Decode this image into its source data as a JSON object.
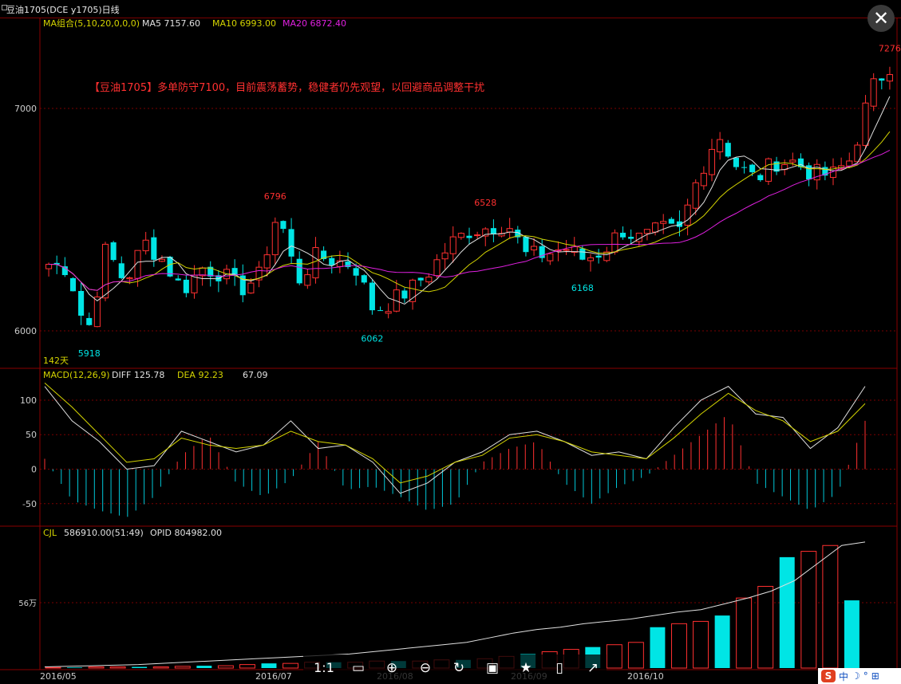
{
  "window": {
    "title": "豆油1705(DCE y1705)日线"
  },
  "toolbar": {
    "ratio_label": "1:1",
    "icons": [
      "fit-screen-icon",
      "zoom-in-icon",
      "zoom-out-icon",
      "rotate-icon",
      "save-icon",
      "bookmark-icon",
      "phone-icon",
      "share-icon"
    ]
  },
  "ime": {
    "logo": "S",
    "lang": "中",
    "moon": "☽",
    "dot": "°",
    "more": "⊞"
  },
  "chart_data": [
    {
      "type": "candlestick",
      "indicator_label": "MA组合(5,10,20,0,0,0)",
      "legend": [
        {
          "name": "MA5",
          "value": "7157.60",
          "color": "#e0e0e0"
        },
        {
          "name": "MA10",
          "value": "6993.00",
          "color": "#d4d400"
        },
        {
          "name": "MA20",
          "value": "6872.40",
          "color": "#e020e0"
        }
      ],
      "annotation": "【豆油1705】多单防守7100，目前震荡蓄势，稳健者仍先观望，以回避商品调整干扰",
      "y_ticks": [
        6000,
        7000
      ],
      "ylim": [
        5860,
        7380
      ],
      "peak_labels": [
        {
          "i": 2,
          "label": "5918",
          "low": true
        },
        {
          "i": 12,
          "label": "6796",
          "low": false
        },
        {
          "i": 17,
          "label": "6062",
          "low": true
        },
        {
          "i": 23,
          "label": "6528",
          "low": false
        },
        {
          "i": 28,
          "label": "6168",
          "low": true
        },
        {
          "i": 44,
          "label": "7276",
          "low": false
        }
      ],
      "bottom_label": "142天",
      "x_ticks": [
        "2016/05",
        "2016/07",
        "2016/08",
        "2016/09",
        "2016/10"
      ],
      "anchors": [
        [
          6330,
          6270
        ],
        [
          6370,
          6195
        ],
        [
          5920,
          6040
        ],
        [
          6440,
          6300
        ],
        [
          6290,
          6140
        ],
        [
          6280,
          6520
        ],
        [
          6400,
          6230
        ],
        [
          6140,
          6220
        ],
        [
          6340,
          6230
        ],
        [
          6180,
          6340
        ],
        [
          6220,
          6150
        ],
        [
          6350,
          6140
        ],
        [
          6440,
          6640
        ],
        [
          6230,
          6210
        ],
        [
          6390,
          6280
        ],
        [
          6290,
          6340
        ],
        [
          6410,
          6180
        ],
        [
          6100,
          6080
        ],
        [
          6100,
          6170
        ],
        [
          6170,
          6210
        ],
        [
          6230,
          6320
        ],
        [
          6290,
          6490
        ],
        [
          6430,
          6470
        ],
        [
          6440,
          6490
        ],
        [
          6510,
          6460
        ],
        [
          6380,
          6290
        ],
        [
          6350,
          6340
        ],
        [
          6370,
          6380
        ],
        [
          6440,
          6200
        ],
        [
          6300,
          6420
        ],
        [
          6430,
          6480
        ],
        [
          6370,
          6450
        ],
        [
          6430,
          6480
        ],
        [
          6350,
          6540
        ],
        [
          6630,
          6770
        ],
        [
          6880,
          6900
        ],
        [
          6780,
          6700
        ],
        [
          6710,
          6650
        ],
        [
          6760,
          6760
        ],
        [
          6680,
          6840
        ],
        [
          6800,
          6610
        ],
        [
          6700,
          6700
        ],
        [
          6760,
          6790
        ],
        [
          6970,
          7190
        ],
        [
          7180,
          7210
        ]
      ]
    },
    {
      "type": "line",
      "indicator_label": "MACD(12,26,9)",
      "legend": [
        {
          "name": "DIFF",
          "value": "125.78",
          "color": "#e0e0e0"
        },
        {
          "name": "DEA",
          "value": "92.23",
          "color": "#d4d400"
        },
        {
          "name": "",
          "value": "67.09",
          "color": "#e0e0e0"
        }
      ],
      "y_ticks": [
        100,
        50,
        0,
        -50
      ],
      "ylim": [
        -78,
        130
      ],
      "diff": [
        120,
        70,
        40,
        0,
        5,
        55,
        40,
        25,
        35,
        70,
        30,
        35,
        10,
        -35,
        -20,
        10,
        25,
        50,
        55,
        40,
        20,
        25,
        15,
        60,
        100,
        120,
        80,
        75,
        30,
        60,
        120
      ],
      "dea": [
        125,
        90,
        50,
        10,
        15,
        45,
        35,
        30,
        35,
        55,
        40,
        35,
        15,
        -20,
        -10,
        10,
        20,
        45,
        50,
        40,
        25,
        20,
        15,
        45,
        80,
        110,
        85,
        70,
        40,
        55,
        95
      ],
      "hist": [
        15,
        -45,
        -60,
        -70,
        -40,
        20,
        50,
        -20,
        -40,
        -15,
        40,
        -30,
        -25,
        -40,
        -60,
        -50,
        10,
        30,
        40,
        -20,
        -50,
        -25,
        -10,
        20,
        50,
        80,
        -20,
        -40,
        -60,
        -35,
        70
      ]
    },
    {
      "type": "bar",
      "indicator_label": "CJL",
      "legend": [
        {
          "name": "",
          "value": "586910.00(51:49)",
          "color": "#e0e0e0"
        },
        {
          "name": "OPID",
          "value": "804982.00",
          "color": "#e0e0e0"
        }
      ],
      "y_ticks_labels": [
        "56万"
      ],
      "y_tick_value": 56,
      "ylim": [
        0,
        112
      ],
      "volume": [
        0.5,
        0.5,
        1,
        1,
        1,
        1,
        1.5,
        2,
        2,
        3,
        4,
        4,
        5,
        5,
        5,
        6,
        6,
        6,
        7,
        7,
        8,
        10,
        12,
        14,
        16,
        18,
        20,
        22,
        35,
        38,
        40,
        45,
        60,
        70,
        95,
        100,
        105,
        58
      ],
      "opid": [
        1,
        1.5,
        2,
        2.5,
        3,
        4,
        5,
        6,
        7,
        8,
        9,
        10,
        11,
        12,
        14,
        16,
        18,
        20,
        22,
        26,
        30,
        33,
        35,
        38,
        40,
        42,
        45,
        48,
        50,
        55,
        60,
        66,
        75,
        90,
        105,
        108
      ]
    }
  ]
}
